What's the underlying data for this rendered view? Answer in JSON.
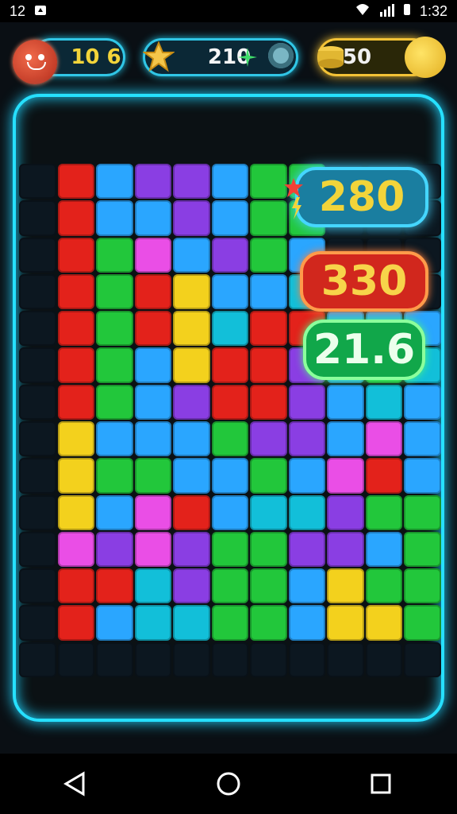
{
  "status": {
    "time": "1:32",
    "left_text": "12",
    "icons": [
      "notification-icon",
      "wifi-icon",
      "signal-icon",
      "battery-icon"
    ]
  },
  "hud": {
    "player_score": "10 6",
    "mid_value": "210",
    "coins": "50"
  },
  "scores": {
    "blue": "280",
    "red": "330",
    "green": "21.6"
  },
  "colors": {
    "accent": "#26e0ff",
    "gold": "#f3d43a",
    "blue_tile": "#2aa6ff",
    "red_tile": "#e3221b",
    "green_tile": "#22c73b",
    "purple_tile": "#8a3ee3",
    "yellow_tile": "#f3d11d",
    "pink_tile": "#ea4ee6",
    "teal_tile": "#12bfd9"
  },
  "board": {
    "rows": 14,
    "cols": 11,
    "cells": [
      "empty",
      "red",
      "blue",
      "purple",
      "purple",
      "blue",
      "green",
      "green",
      "empty",
      "empty",
      "empty",
      "empty",
      "red",
      "blue",
      "blue",
      "purple",
      "blue",
      "green",
      "green",
      "empty",
      "empty",
      "empty",
      "empty",
      "red",
      "green",
      "pink",
      "blue",
      "purple",
      "green",
      "blue",
      "empty",
      "empty",
      "empty",
      "empty",
      "red",
      "green",
      "red",
      "yellow",
      "blue",
      "blue",
      "teal",
      "empty",
      "empty",
      "empty",
      "empty",
      "red",
      "green",
      "red",
      "yellow",
      "teal",
      "red",
      "red",
      "blue",
      "blue",
      "blue",
      "empty",
      "red",
      "green",
      "blue",
      "yellow",
      "red",
      "red",
      "purple",
      "blue",
      "green",
      "teal",
      "empty",
      "red",
      "green",
      "blue",
      "purple",
      "red",
      "red",
      "purple",
      "blue",
      "teal",
      "blue",
      "empty",
      "yellow",
      "blue",
      "blue",
      "blue",
      "green",
      "purple",
      "purple",
      "blue",
      "pink",
      "blue",
      "empty",
      "yellow",
      "green",
      "green",
      "blue",
      "blue",
      "green",
      "blue",
      "pink",
      "red",
      "blue",
      "empty",
      "yellow",
      "blue",
      "pink",
      "red",
      "blue",
      "teal",
      "teal",
      "purple",
      "green",
      "green",
      "empty",
      "pink",
      "purple",
      "pink",
      "purple",
      "green",
      "green",
      "purple",
      "purple",
      "blue",
      "green",
      "empty",
      "red",
      "red",
      "teal",
      "purple",
      "green",
      "green",
      "blue",
      "yellow",
      "green",
      "green",
      "empty",
      "red",
      "blue",
      "teal",
      "teal",
      "green",
      "green",
      "blue",
      "yellow",
      "yellow",
      "green",
      "empty",
      "empty",
      "empty",
      "empty",
      "empty",
      "empty",
      "empty",
      "empty",
      "empty",
      "empty",
      "empty"
    ]
  }
}
